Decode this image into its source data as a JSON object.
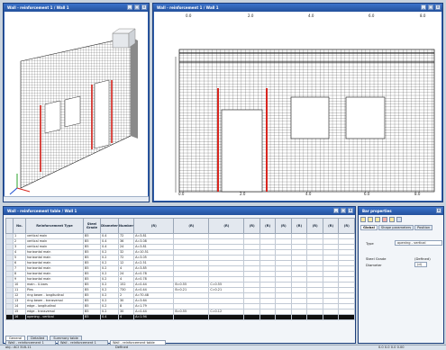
{
  "windows": {
    "iso_title": "Wall - reinforcement 1 / Wall 1",
    "front_title": "Wall - reinforcement 1 / Wall 1",
    "table_title": "Wall - reinforcement table / Wall 1",
    "props_title": "Bar properties"
  },
  "ruler": {
    "top": [
      "0.0",
      "2.0",
      "4.0",
      "6.0",
      "8.0"
    ],
    "bottom": [
      "0.0",
      "2.0",
      "4.0",
      "6.0",
      "8.0"
    ]
  },
  "table": {
    "headers": [
      "No.",
      "Reinforcement Type",
      "Steel Grade",
      "Diameter",
      "Number",
      "(R)",
      "(R)",
      "(R)",
      "(R)",
      "(R)",
      "(R)",
      "(R)",
      "(R)",
      "(R)",
      "(R)"
    ],
    "rows": [
      [
        "1",
        "vertical main",
        "B5",
        "0.4",
        "72",
        "A=3.81",
        "",
        "",
        "",
        "",
        "",
        "",
        "",
        "",
        ""
      ],
      [
        "2",
        "vertical main",
        "B5",
        "0.4",
        "36",
        "A=3.08",
        "",
        "",
        "",
        "",
        "",
        "",
        "",
        "",
        ""
      ],
      [
        "3",
        "vertical main",
        "B5",
        "0.4",
        "24",
        "A=3.81",
        "",
        "",
        "",
        "",
        "",
        "",
        "",
        "",
        ""
      ],
      [
        "4",
        "horizontal main",
        "B5",
        "0.2",
        "32",
        "A=10.51",
        "",
        "",
        "",
        "",
        "",
        "",
        "",
        "",
        ""
      ],
      [
        "5",
        "horizontal main",
        "B5",
        "0.2",
        "72",
        "A=3.05",
        "",
        "",
        "",
        "",
        "",
        "",
        "",
        "",
        ""
      ],
      [
        "6",
        "horizontal main",
        "B5",
        "0.2",
        "12",
        "A=2.51",
        "",
        "",
        "",
        "",
        "",
        "",
        "",
        "",
        ""
      ],
      [
        "7",
        "horizontal main",
        "B5",
        "0.2",
        "4",
        "A=3.85",
        "",
        "",
        "",
        "",
        "",
        "",
        "",
        "",
        ""
      ],
      [
        "8",
        "horizontal main",
        "B5",
        "0.2",
        "24",
        "A=0.78",
        "",
        "",
        "",
        "",
        "",
        "",
        "",
        "",
        ""
      ],
      [
        "9",
        "horizontal main",
        "B5",
        "0.2",
        "4",
        "A=0.78",
        "",
        "",
        "",
        "",
        "",
        "",
        "",
        "",
        ""
      ],
      [
        "10",
        "main - U-bars",
        "B5",
        "0.2",
        "152",
        "A=0.44",
        "B=0.55",
        "C=0.55",
        "",
        "",
        "",
        "",
        "",
        "",
        ""
      ],
      [
        "11",
        "Pins",
        "B5",
        "0.2",
        "730",
        "A=0.44",
        "B=0.21",
        "C=0.21",
        "",
        "",
        "",
        "",
        "",
        "",
        ""
      ],
      [
        "12",
        "ring beam - longitudinal",
        "B5",
        "0.2",
        "2",
        "A=70.48",
        "",
        "",
        "",
        "",
        "",
        "",
        "",
        "",
        ""
      ],
      [
        "13",
        "ring beam - transversal",
        "B5",
        "0.2",
        "30",
        "A=3.64",
        "",
        "",
        "",
        "",
        "",
        "",
        "",
        "",
        ""
      ],
      [
        "14",
        "edge - longitudinal",
        "B5",
        "0.2",
        "8",
        "A=1.79",
        "",
        "",
        "",
        "",
        "",
        "",
        "",
        "",
        ""
      ],
      [
        "15",
        "edge - transversal",
        "B5",
        "0.2",
        "30",
        "A=0.44",
        "B=0.55",
        "C=0.12",
        "",
        "",
        "",
        "",
        "",
        "",
        ""
      ],
      [
        "16",
        "opening - vertical",
        "B5",
        "0.4",
        "4",
        "A=1.94",
        "",
        "",
        "",
        "",
        "",
        "",
        "",
        "",
        ""
      ]
    ],
    "tabs": [
      "General",
      "Detailed",
      "Summary table"
    ]
  },
  "props": {
    "tabs": [
      "Global",
      "Shape parameters",
      "Position"
    ],
    "type_label": "Type",
    "type_value": "opening - vertical",
    "grade_label": "Steel Grade",
    "grade_value": "(Defined)",
    "diam_label": "Diameter",
    "diam_value": "(d)"
  },
  "statusbar": {
    "tabs": [
      "Wall - reinforcement 1",
      "Wall - reinforcement 1",
      "Wall - reinforcement table"
    ],
    "left": "obj.: ACI 318-11",
    "mid": "Defined",
    "right": "0.0  0.0  0.0  0.00"
  },
  "colors": {
    "accent": "#2f5fb0",
    "rebar": "#d8261f",
    "mesh": "#1f1f1f"
  }
}
